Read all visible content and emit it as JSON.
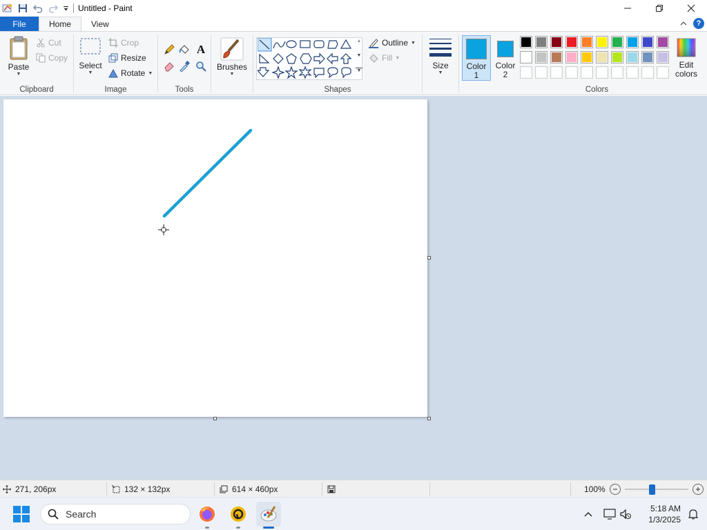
{
  "window": {
    "title": "Untitled - Paint",
    "minimize_glyph": "—",
    "maximize_glyph": "❐",
    "close_glyph": "✕"
  },
  "tabs": {
    "file": "File",
    "home": "Home",
    "view": "View",
    "help_glyph": "?"
  },
  "clipboard": {
    "label": "Clipboard",
    "paste": "Paste",
    "cut": "Cut",
    "copy": "Copy"
  },
  "image": {
    "label": "Image",
    "select": "Select",
    "crop": "Crop",
    "resize": "Resize",
    "rotate": "Rotate"
  },
  "tools": {
    "label": "Tools",
    "text_glyph": "A"
  },
  "brushes": {
    "label": "Brushes"
  },
  "shapes": {
    "label": "Shapes",
    "outline": "Outline",
    "fill": "Fill"
  },
  "size": {
    "label": "Size"
  },
  "colors": {
    "label": "Colors",
    "color1_line1": "Color",
    "color1_line2": "1",
    "color2_line1": "Color",
    "color2_line2": "2",
    "edit_line1": "Edit",
    "edit_line2": "colors",
    "color1_value": "#0aa3e0",
    "color2_value": "#0aa3e0",
    "palette_row1": [
      "#000000",
      "#7f7f7f",
      "#880015",
      "#ed1c24",
      "#ff7f27",
      "#fff200",
      "#22b14c",
      "#00a2e8",
      "#3f48cc",
      "#a349a4"
    ],
    "palette_row2": [
      "#ffffff",
      "#c3c3c3",
      "#b97a57",
      "#ffaec9",
      "#ffc90e",
      "#efe4b0",
      "#b5e61d",
      "#99d9ea",
      "#7092be",
      "#c8bfe7"
    ],
    "palette_row3": [
      "#ffffff",
      "#ffffff",
      "#ffffff",
      "#ffffff",
      "#ffffff",
      "#ffffff",
      "#ffffff",
      "#ffffff",
      "#ffffff",
      "#ffffff"
    ]
  },
  "canvas": {
    "stroke_color": "#1ba1d2"
  },
  "status": {
    "cursor_pos": "271, 206px",
    "selection_size": "132 × 132px",
    "canvas_size": "614 × 460px",
    "zoom": "100%",
    "zoom_level": 1.0
  },
  "taskbar": {
    "search_placeholder": "Search",
    "time": "5:18 AM",
    "date": "1/3/2025"
  }
}
